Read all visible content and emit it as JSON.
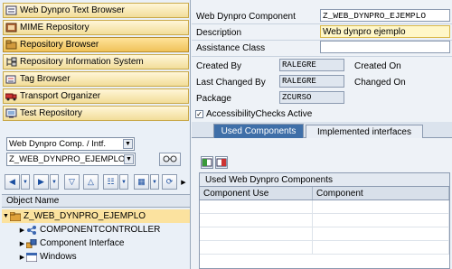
{
  "nav": {
    "items": [
      {
        "label": "Web Dynpro Text Browser",
        "icon": "text-browser-icon"
      },
      {
        "label": "MIME Repository",
        "icon": "mime-repository-icon"
      },
      {
        "label": "Repository Browser",
        "icon": "repository-browser-icon",
        "active": true
      },
      {
        "label": "Repository Information System",
        "icon": "info-system-icon"
      },
      {
        "label": "Tag Browser",
        "icon": "tag-browser-icon"
      },
      {
        "label": "Transport Organizer",
        "icon": "transport-organizer-icon"
      },
      {
        "label": "Test Repository",
        "icon": "test-repository-icon"
      }
    ]
  },
  "object_selector": {
    "type_value": "Web Dynpro Comp. / Intf.",
    "name_value": "Z_WEB_DYNPRO_EJEMPLO"
  },
  "tree": {
    "header": "Object Name",
    "root": "Z_WEB_DYNPRO_EJEMPLO",
    "children": [
      "COMPONENTCONTROLLER",
      "Component Interface",
      "Windows"
    ]
  },
  "form": {
    "component_label": "Web Dynpro Component",
    "component_value": "Z_WEB_DYNPRO_EJEMPLO",
    "description_label": "Description",
    "description_value": "Web dynpro ejemplo",
    "assistance_label": "Assistance Class",
    "assistance_value": "",
    "created_by_label": "Created By",
    "created_by_value": "RALEGRE",
    "created_on_label": "Created On",
    "last_changed_label": "Last Changed By",
    "last_changed_value": "RALEGRE",
    "changed_on_label": "Changed On",
    "package_label": "Package",
    "package_value": "ZCURSO",
    "accessibility_label": "AccessibilityChecks Active",
    "accessibility_checked": true
  },
  "tabs": [
    {
      "label": "Used Components",
      "active": true
    },
    {
      "label": "Implemented interfaces",
      "active": false
    }
  ],
  "used_components_table": {
    "title": "Used Web Dynpro Components",
    "columns": [
      "Component Use",
      "Component"
    ],
    "rows": [
      [
        "",
        ""
      ],
      [
        "",
        ""
      ],
      [
        "",
        ""
      ],
      [
        "",
        ""
      ]
    ]
  },
  "colors": {
    "nav_button": "#f2dd99",
    "nav_active": "#f0c25a",
    "tab_active": "#3f6fa8",
    "highlight_field": "#fff7c8"
  }
}
